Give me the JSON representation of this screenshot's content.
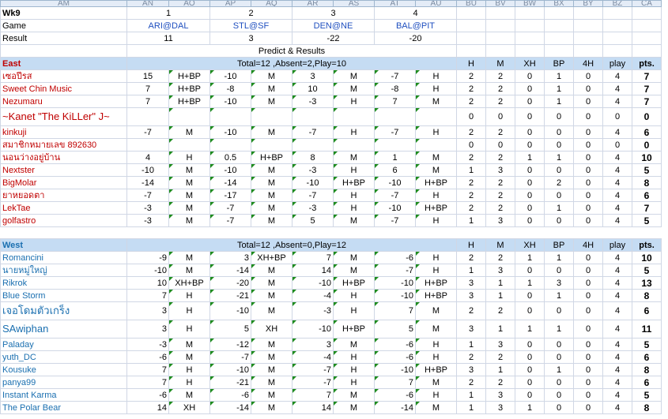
{
  "columns": [
    "AM",
    "AN",
    "AO",
    "AP",
    "AQ",
    "AR",
    "AS",
    "AT",
    "AU",
    "BU",
    "BV",
    "BW",
    "BX",
    "BY",
    "BZ",
    "CA"
  ],
  "week": "Wk9",
  "games": {
    "row_label": "Game",
    "numbers": [
      "1",
      "2",
      "3",
      "4"
    ],
    "names": [
      "ARI@DAL",
      "STL@SF",
      "DEN@NE",
      "BAL@PIT"
    ],
    "result_label": "Result",
    "results": [
      "11",
      "3",
      "-22",
      "-20"
    ]
  },
  "predict_title": "Predict & Results",
  "score_headers": [
    "H",
    "M",
    "XH",
    "BP",
    "4H",
    "play",
    "pts."
  ],
  "east": {
    "name": "East",
    "summary": "Total=12 ,Absent=2,Play=10",
    "rows": [
      {
        "name": "เซอปีรส",
        "picks": [
          "15",
          "H+BP",
          "-10",
          "M",
          "3",
          "M",
          "-7",
          "H"
        ],
        "scores": [
          "2",
          "2",
          "0",
          "1",
          "0",
          "4",
          "7"
        ]
      },
      {
        "name": "Sweet Chin Music",
        "picks": [
          "7",
          "H+BP",
          "-8",
          "M",
          "10",
          "M",
          "-8",
          "H"
        ],
        "scores": [
          "2",
          "2",
          "0",
          "1",
          "0",
          "4",
          "7"
        ]
      },
      {
        "name": "Nezumaru",
        "picks": [
          "7",
          "H+BP",
          "-10",
          "M",
          "-3",
          "H",
          "7",
          "M"
        ],
        "scores": [
          "2",
          "2",
          "0",
          "1",
          "0",
          "4",
          "7"
        ]
      },
      {
        "name": "~Kanet \"The KiLLer\" J~",
        "picks": [
          "",
          "",
          "",
          "",
          "",
          "",
          "",
          ""
        ],
        "scores": [
          "0",
          "0",
          "0",
          "0",
          "0",
          "0",
          "0"
        ],
        "tall": true
      },
      {
        "name": "kinkuji",
        "picks": [
          "-7",
          "M",
          "-10",
          "M",
          "-7",
          "H",
          "-7",
          "H"
        ],
        "scores": [
          "2",
          "2",
          "0",
          "0",
          "0",
          "4",
          "6"
        ]
      },
      {
        "name": "สมาชิกหมายเลข 892630",
        "picks": [
          "",
          "",
          "",
          "",
          "",
          "",
          "",
          ""
        ],
        "scores": [
          "0",
          "0",
          "0",
          "0",
          "0",
          "0",
          "0"
        ]
      },
      {
        "name": "นอนว่างอยู่บ้าน",
        "picks": [
          "4",
          "H",
          "0.5",
          "H+BP",
          "8",
          "M",
          "1",
          "M"
        ],
        "scores": [
          "2",
          "2",
          "1",
          "1",
          "0",
          "4",
          "10"
        ]
      },
      {
        "name": "Nextster",
        "picks": [
          "-10",
          "M",
          "-10",
          "M",
          "-3",
          "H",
          "6",
          "M"
        ],
        "scores": [
          "1",
          "3",
          "0",
          "0",
          "0",
          "4",
          "5"
        ]
      },
      {
        "name": "BigMolar",
        "picks": [
          "-14",
          "M",
          "-14",
          "M",
          "-10",
          "H+BP",
          "-10",
          "H+BP"
        ],
        "scores": [
          "2",
          "2",
          "0",
          "2",
          "0",
          "4",
          "8"
        ]
      },
      {
        "name": "ยาหยอดตา",
        "picks": [
          "-7",
          "M",
          "-17",
          "M",
          "-7",
          "H",
          "-7",
          "H"
        ],
        "scores": [
          "2",
          "2",
          "0",
          "0",
          "0",
          "4",
          "6"
        ]
      },
      {
        "name": "LekTae",
        "picks": [
          "-3",
          "M",
          "-7",
          "M",
          "-3",
          "H",
          "-10",
          "H+BP"
        ],
        "scores": [
          "2",
          "2",
          "0",
          "1",
          "0",
          "4",
          "7"
        ]
      },
      {
        "name": "golfastro",
        "picks": [
          "-3",
          "M",
          "-7",
          "M",
          "5",
          "M",
          "-7",
          "H"
        ],
        "scores": [
          "1",
          "3",
          "0",
          "0",
          "0",
          "4",
          "5"
        ]
      }
    ]
  },
  "west": {
    "name": "West",
    "summary": "Total=12 ,Absent=0,Play=12",
    "rows": [
      {
        "name": "Romancini",
        "picks": [
          "-9",
          "M",
          "3",
          "XH+BP",
          "7",
          "M",
          "-6",
          "H"
        ],
        "scores": [
          "2",
          "2",
          "1",
          "1",
          "0",
          "4",
          "10"
        ]
      },
      {
        "name": "นายหมู่ใหญ่",
        "picks": [
          "-10",
          "M",
          "-14",
          "M",
          "14",
          "M",
          "-7",
          "H"
        ],
        "scores": [
          "1",
          "3",
          "0",
          "0",
          "0",
          "4",
          "5"
        ]
      },
      {
        "name": "Rikrok",
        "picks": [
          "10",
          "XH+BP",
          "-20",
          "M",
          "-10",
          "H+BP",
          "-10",
          "H+BP"
        ],
        "scores": [
          "3",
          "1",
          "1",
          "3",
          "0",
          "4",
          "13"
        ]
      },
      {
        "name": "Blue Storm",
        "picks": [
          "7",
          "H",
          "-21",
          "M",
          "-4",
          "H",
          "-10",
          "H+BP"
        ],
        "scores": [
          "3",
          "1",
          "0",
          "1",
          "0",
          "4",
          "8"
        ]
      },
      {
        "name": "เจอโดมตัวเกร็ง",
        "picks": [
          "3",
          "H",
          "-10",
          "M",
          "-3",
          "H",
          "7",
          "M"
        ],
        "scores": [
          "2",
          "2",
          "0",
          "0",
          "0",
          "4",
          "6"
        ],
        "tall": true
      },
      {
        "name": "SAwiphan",
        "picks": [
          "3",
          "H",
          "5",
          "XH",
          "-10",
          "H+BP",
          "5",
          "M"
        ],
        "scores": [
          "3",
          "1",
          "1",
          "1",
          "0",
          "4",
          "11"
        ],
        "tall": true
      },
      {
        "name": "Paladay",
        "picks": [
          "-3",
          "M",
          "-12",
          "M",
          "3",
          "M",
          "-6",
          "H"
        ],
        "scores": [
          "1",
          "3",
          "0",
          "0",
          "0",
          "4",
          "5"
        ]
      },
      {
        "name": "yuth_DC",
        "picks": [
          "-6",
          "M",
          "-7",
          "M",
          "-4",
          "H",
          "-6",
          "H"
        ],
        "scores": [
          "2",
          "2",
          "0",
          "0",
          "0",
          "4",
          "6"
        ]
      },
      {
        "name": "Kousuke",
        "picks": [
          "7",
          "H",
          "-10",
          "M",
          "-7",
          "H",
          "-10",
          "H+BP"
        ],
        "scores": [
          "3",
          "1",
          "0",
          "1",
          "0",
          "4",
          "8"
        ]
      },
      {
        "name": "panya99",
        "picks": [
          "7",
          "H",
          "-21",
          "M",
          "-7",
          "H",
          "7",
          "M"
        ],
        "scores": [
          "2",
          "2",
          "0",
          "0",
          "0",
          "4",
          "6"
        ]
      },
      {
        "name": "Instant Karma",
        "picks": [
          "-6",
          "M",
          "-6",
          "M",
          "7",
          "M",
          "-6",
          "H"
        ],
        "scores": [
          "1",
          "3",
          "0",
          "0",
          "0",
          "4",
          "5"
        ]
      },
      {
        "name": "The Polar Bear",
        "picks": [
          "14",
          "XH",
          "-14",
          "M",
          "14",
          "M",
          "-14",
          "M"
        ],
        "scores": [
          "1",
          "3",
          "1",
          "0",
          "0",
          "4",
          "8"
        ]
      }
    ]
  }
}
